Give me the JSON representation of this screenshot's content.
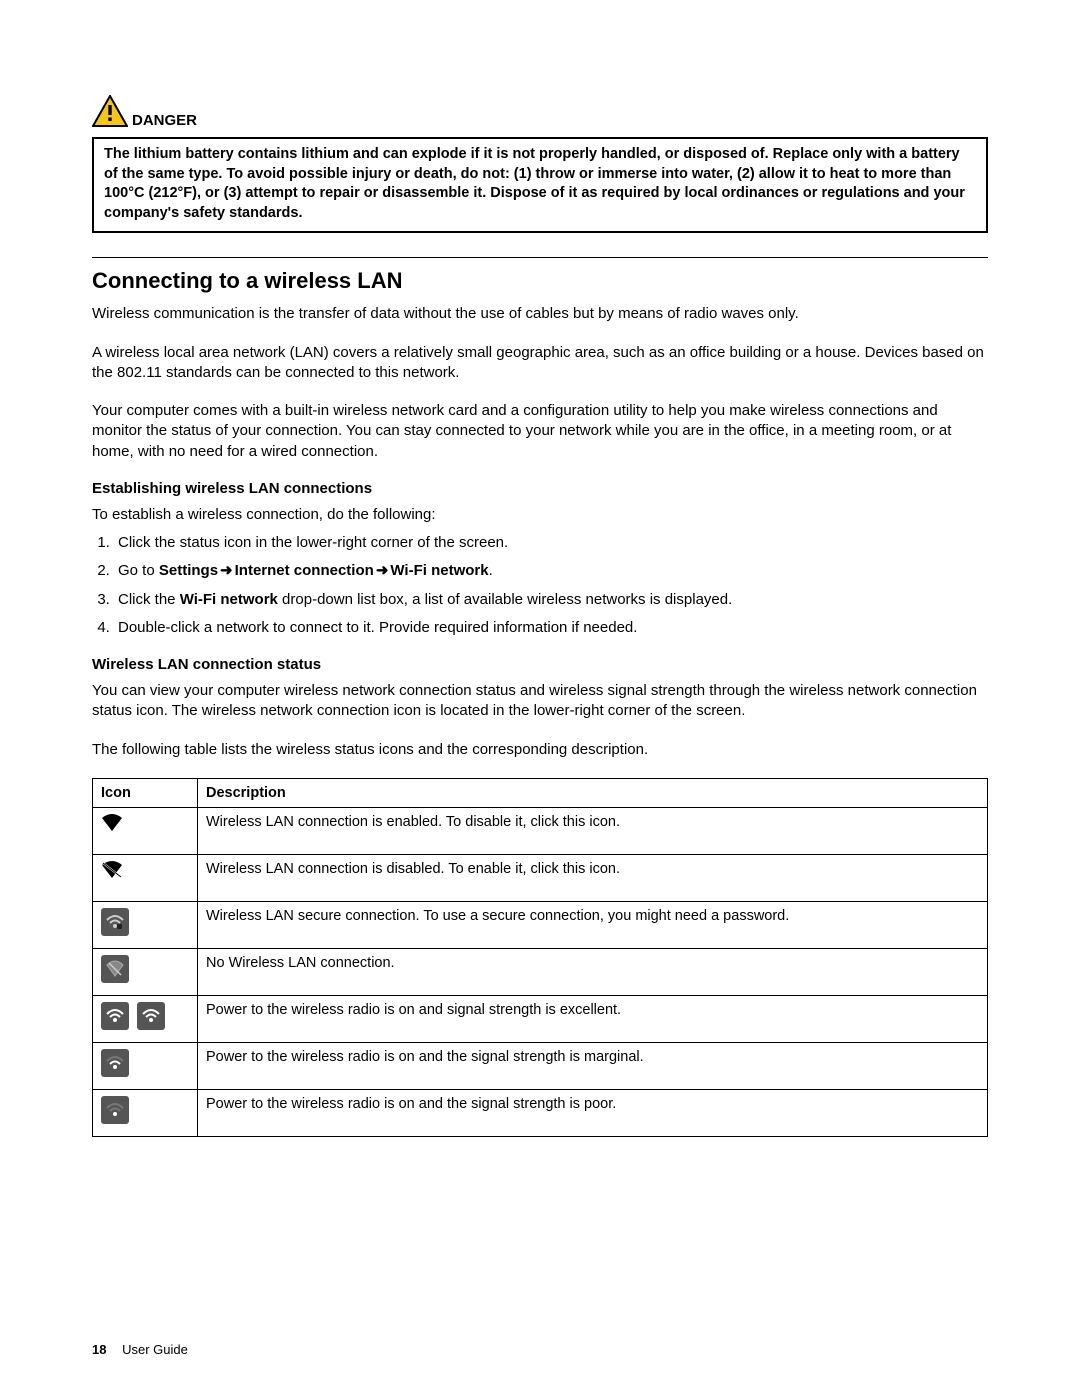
{
  "danger": {
    "label": "DANGER",
    "text": "The lithium battery contains lithium and can explode if it is not properly handled, or disposed of. Replace only with a battery of the same type. To avoid possible injury or death, do not: (1) throw or immerse into water, (2) allow it to heat to more than 100°C (212°F), or (3) attempt to repair or disassemble it. Dispose of it as required by local ordinances or regulations and your company's safety standards."
  },
  "section": {
    "title": "Connecting to a wireless LAN",
    "p1": "Wireless communication is the transfer of data without the use of cables but by means of radio waves only.",
    "p2": "A wireless local area network (LAN) covers a relatively small geographic area, such as an office building or a house. Devices based on the 802.11 standards can be connected to this network.",
    "p3": "Your computer comes with a built-in wireless network card and a configuration utility to help you make wireless connections and monitor the status of your connection. You can stay connected to your network while you are in the office, in a meeting room, or at home, with no need for a wired connection."
  },
  "establish": {
    "heading": "Establishing wireless LAN connections",
    "intro": "To establish a wireless connection, do the following:",
    "step1": "Click the status icon in the lower-right corner of the screen.",
    "step2_a": "Go to ",
    "step2_b": "Settings",
    "step2_c": "Internet connection",
    "step2_d": "Wi-Fi network",
    "step3_a": "Click the ",
    "step3_b": "Wi-Fi network",
    "step3_c": " drop-down list box, a list of available wireless networks is displayed.",
    "step4": "Double-click a network to connect to it. Provide required information if needed."
  },
  "status": {
    "heading": "Wireless LAN connection status",
    "p1": "You can view your computer wireless network connection status and wireless signal strength through the wireless network connection status icon. The wireless network connection icon is located in the lower-right corner of the screen.",
    "p2": "The following table lists the wireless status icons and the corresponding description."
  },
  "table": {
    "h_icon": "Icon",
    "h_desc": "Description",
    "r1": "Wireless LAN connection is enabled. To disable it, click this icon.",
    "r2": "Wireless LAN connection is disabled. To enable it, click this icon.",
    "r3": "Wireless LAN secure connection. To use a secure connection, you might need a password.",
    "r4": "No Wireless LAN connection.",
    "r5": "Power to the wireless radio is on and signal strength is excellent.",
    "r6": "Power to the wireless radio is on and the signal strength is marginal.",
    "r7": "Power to the wireless radio is on and the signal strength is poor."
  },
  "footer": {
    "page": "18",
    "title": "User Guide"
  },
  "arrow": "➜"
}
